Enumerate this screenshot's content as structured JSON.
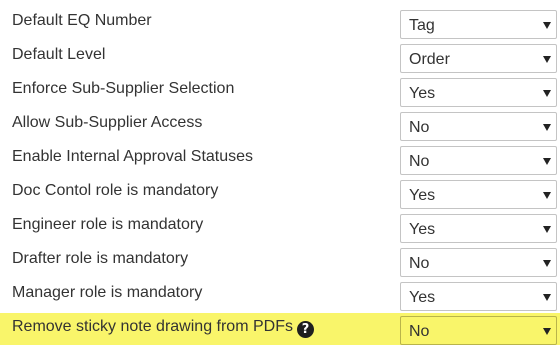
{
  "settings": {
    "rows": [
      {
        "label": "Default EQ Number",
        "value": "Tag"
      },
      {
        "label": "Default Level",
        "value": "Order"
      },
      {
        "label": "Enforce Sub-Supplier Selection",
        "value": "Yes"
      },
      {
        "label": "Allow Sub-Supplier Access",
        "value": "No"
      },
      {
        "label": "Enable Internal Approval Statuses",
        "value": "No"
      },
      {
        "label": "Doc Contol role is mandatory",
        "value": "Yes"
      },
      {
        "label": "Engineer role is mandatory",
        "value": "Yes"
      },
      {
        "label": "Drafter role is mandatory",
        "value": "No"
      },
      {
        "label": "Manager role is mandatory",
        "value": "Yes"
      },
      {
        "label": "Remove sticky note drawing from PDFs",
        "value": "No",
        "help_icon": "question-circle-icon",
        "highlighted": true
      }
    ]
  },
  "colors": {
    "highlight": "#f9f56a",
    "text": "#333333",
    "select_border": "#c4c4c4"
  }
}
